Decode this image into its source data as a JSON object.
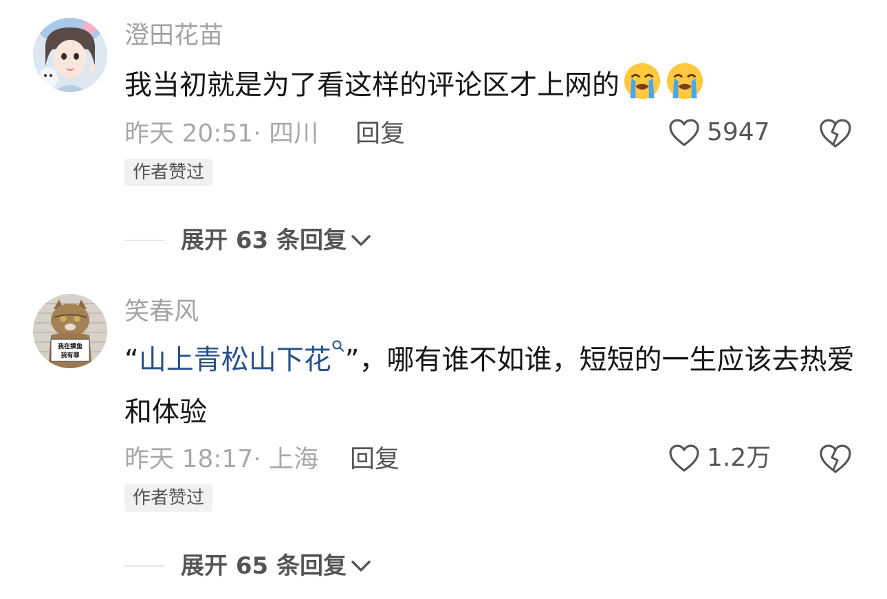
{
  "comments": [
    {
      "username": "澄田花苗",
      "text": "我当初就是为了看这样的评论区才上网的",
      "emoji": [
        "loudly-crying-face-emoji",
        "loudly-crying-face-emoji"
      ],
      "time": "昨天 20:51",
      "location": "· 四川",
      "reply_label": "回复",
      "likes": "5947",
      "badge": "作者赞过",
      "expand_label": "展开 63 条回复"
    },
    {
      "username": "笑春风",
      "text_prefix": "“",
      "link_text": "山上青松山下花",
      "text_suffix": "”，哪有谁不如谁，短短的一生应该去热爱和体验",
      "avatar_sign_line1": "我在摸鱼",
      "avatar_sign_line2": "我有罪",
      "time": "昨天 18:17",
      "location": "· 上海",
      "reply_label": "回复",
      "likes": "1.2万",
      "badge": "作者赞过",
      "expand_label": "展开 65 条回复"
    }
  ],
  "colors": {
    "username": "#a3a3a3",
    "body_text": "#161616",
    "link": "#25508a",
    "meta": "#a9a9a9",
    "action": "#555555",
    "badge_bg": "#f1f1f3"
  }
}
